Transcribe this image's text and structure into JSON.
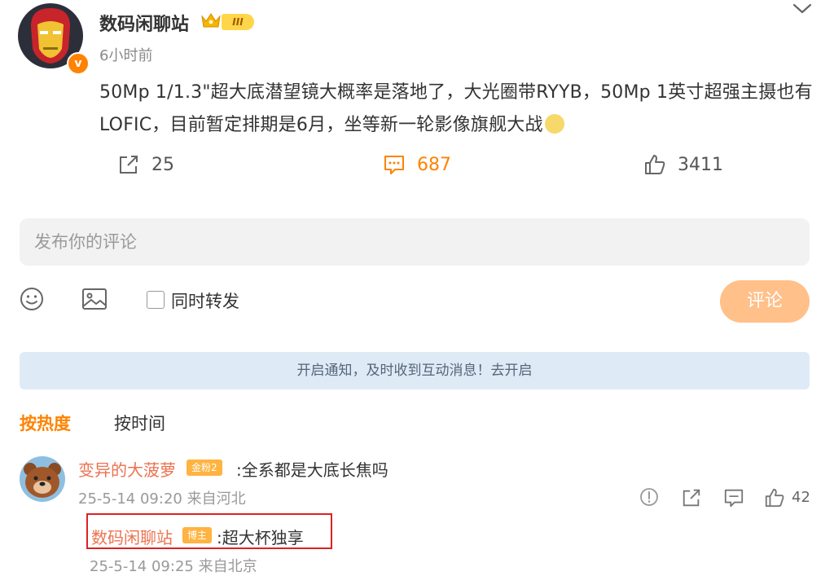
{
  "post": {
    "author": "数码闲聊站",
    "level_badge": "III",
    "verified_badge": "v",
    "time": "6小时前",
    "content": "50Mp 1/1.3\"超大底潜望镜大概率是落地了，大光圈带RYYB，50Mp 1英寸超强主摄也有LOFIC，目前暂定排期是6月，坐等新一轮影像旗舰大战",
    "repost_count": "25",
    "comment_count": "687",
    "like_count": "3411",
    "accent_color": "#ff8200"
  },
  "composer": {
    "placeholder": "发布你的评论",
    "forward_label": "同时转发",
    "submit_label": "评论"
  },
  "notice": "开启通知，及时收到互动消息！去开启",
  "sort": {
    "hot_label": "按热度",
    "time_label": "按时间"
  },
  "comment": {
    "user": "变异的大菠萝",
    "badge": "金粉2",
    "text": ":全系都是大底长焦吗",
    "meta": "25-5-14 09:20 来自河北",
    "like_count": "42"
  },
  "reply": {
    "user": "数码闲聊站",
    "badge": "博主",
    "text": ":超大杯独享",
    "meta": "25-5-14 09:25 来自北京"
  },
  "icons": [
    "iron-man-avatar",
    "crown-icon",
    "chevron-down-icon",
    "repost-icon",
    "comment-icon",
    "thumbs-up-icon",
    "smiley-icon",
    "image-icon",
    "bear-avatar",
    "report-icon",
    "share-icon",
    "reply-icon"
  ]
}
